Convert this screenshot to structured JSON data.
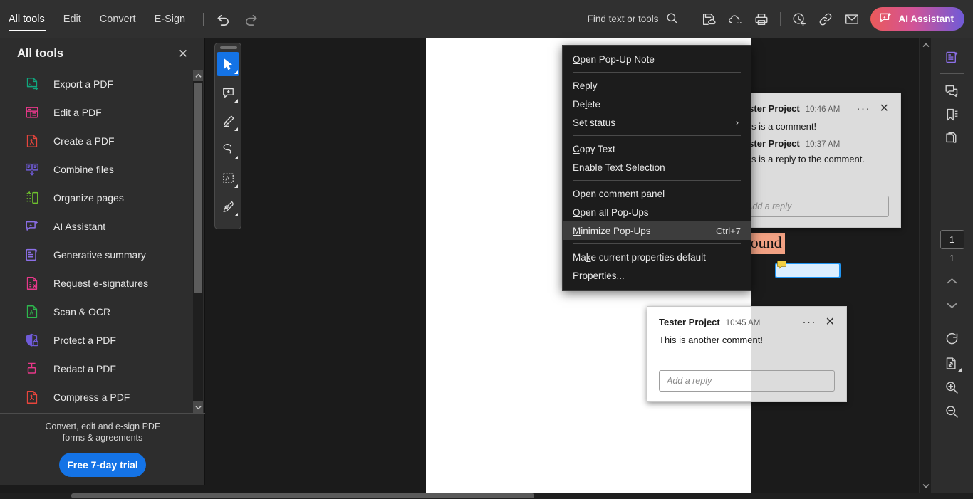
{
  "topbar": {
    "tabs": [
      {
        "label": "All tools",
        "active": true
      },
      {
        "label": "Edit",
        "active": false
      },
      {
        "label": "Convert",
        "active": false
      },
      {
        "label": "E-Sign",
        "active": false
      }
    ],
    "undo_icon": "undo-icon",
    "redo_icon": "redo-icon",
    "find_placeholder": "Find text or tools",
    "search_icon": "search-icon",
    "actions": [
      {
        "name": "save-to-cloud-icon",
        "label": "Save"
      },
      {
        "name": "cloud-storage-icon",
        "label": "Cloud"
      },
      {
        "name": "print-icon",
        "label": "Print"
      },
      {
        "name": "add-stamp-icon",
        "label": "Add Stamp"
      },
      {
        "name": "share-link-icon",
        "label": "Share link"
      },
      {
        "name": "email-icon",
        "label": "Email"
      }
    ],
    "ai_assistant": {
      "label": "AI Assistant",
      "icon": "ai-sparkle-icon",
      "gradient_from": "#eb5a5a",
      "gradient_to": "#6f5bd8"
    }
  },
  "sidebar": {
    "title": "All tools",
    "close_icon": "close-icon",
    "items": [
      {
        "label": "Export a PDF",
        "icon": "export-pdf-icon",
        "color": "#0fa87f"
      },
      {
        "label": "Edit a PDF",
        "icon": "edit-pdf-icon",
        "color": "#e8388a"
      },
      {
        "label": "Create a PDF",
        "icon": "create-pdf-icon",
        "color": "#e8453c"
      },
      {
        "label": "Combine files",
        "icon": "combine-files-icon",
        "color": "#6f5bd8"
      },
      {
        "label": "Organize pages",
        "icon": "organize-pages-icon",
        "color": "#6ec02e"
      },
      {
        "label": "AI Assistant",
        "icon": "ai-assistant-icon",
        "color": "#8c6fe8"
      },
      {
        "label": "Generative summary",
        "icon": "generative-summary-icon",
        "color": "#8c6fe8"
      },
      {
        "label": "Request e-signatures",
        "icon": "request-esignatures-icon",
        "color": "#e8388a"
      },
      {
        "label": "Scan & OCR",
        "icon": "scan-ocr-icon",
        "color": "#2db84d"
      },
      {
        "label": "Protect a PDF",
        "icon": "protect-pdf-icon",
        "color": "#6f5bd8"
      },
      {
        "label": "Redact a PDF",
        "icon": "redact-pdf-icon",
        "color": "#e8388a"
      },
      {
        "label": "Compress a PDF",
        "icon": "compress-pdf-icon",
        "color": "#e8453c"
      }
    ],
    "footer": {
      "promo": "Convert, edit and e-sign PDF forms & agreements",
      "trial_button": "Free 7-day trial",
      "trial_color": "#1473e6"
    }
  },
  "annotation_toolbar": {
    "tools": [
      {
        "name": "select-tool",
        "icon": "cursor-arrow-icon",
        "active": true
      },
      {
        "name": "add-comment-tool",
        "icon": "comment-plus-icon",
        "active": false
      },
      {
        "name": "highlight-tool",
        "icon": "highlighter-icon",
        "active": false
      },
      {
        "name": "freehand-tool",
        "icon": "lasso-icon",
        "active": false
      },
      {
        "name": "text-selection-tool",
        "icon": "text-box-a-icon",
        "active": false
      },
      {
        "name": "signature-tool",
        "icon": "fountain-pen-icon",
        "active": false
      }
    ]
  },
  "document": {
    "highlighted_text": "The Hound",
    "highlight_color": "#f2a183",
    "note_icon": "sticky-note-icon",
    "selection_icon": "sticky-note-small-icon"
  },
  "context_menu": {
    "items": [
      {
        "label": "Open Pop-Up Note",
        "mnemonic": "O",
        "shortcut": "",
        "submenu": false,
        "highlight": false
      },
      {
        "separator": true
      },
      {
        "label": "Reply",
        "mnemonic": "y",
        "shortcut": "",
        "submenu": false,
        "highlight": false
      },
      {
        "label": "Delete",
        "mnemonic": "l",
        "shortcut": "",
        "submenu": false,
        "highlight": false
      },
      {
        "label": "Set status",
        "mnemonic": "t",
        "shortcut": "",
        "submenu": true,
        "highlight": false
      },
      {
        "separator": true
      },
      {
        "label": "Copy Text",
        "mnemonic": "C",
        "shortcut": "",
        "submenu": false,
        "highlight": false
      },
      {
        "label": "Enable Text Selection",
        "mnemonic": "T",
        "shortcut": "",
        "submenu": false,
        "highlight": false
      },
      {
        "separator": true
      },
      {
        "label": "Open comment panel",
        "mnemonic": "",
        "shortcut": "",
        "submenu": false,
        "highlight": false
      },
      {
        "label": "Open all Pop-Ups",
        "mnemonic": "O",
        "shortcut": "",
        "submenu": false,
        "highlight": false
      },
      {
        "label": "Minimize Pop-Ups",
        "mnemonic": "M",
        "shortcut": "Ctrl+7",
        "submenu": false,
        "highlight": true
      },
      {
        "separator": true
      },
      {
        "label": "Make current properties default",
        "mnemonic": "k",
        "shortcut": "",
        "submenu": false,
        "highlight": false
      },
      {
        "label": "Properties...",
        "mnemonic": "P",
        "shortcut": "",
        "submenu": false,
        "highlight": false
      }
    ]
  },
  "popups": [
    {
      "id": "popup-upper",
      "author": "Tester Project",
      "time": "10:46 AM",
      "body": "This is a comment!",
      "reply_author": "Tester Project",
      "reply_time": "10:37 AM",
      "reply_body": "This is a reply to the comment.",
      "reply_placeholder": "Add a reply",
      "more_icon": "more-options-icon",
      "close_icon": "close-icon"
    },
    {
      "id": "popup-lower",
      "author": "Tester Project",
      "time": "10:45 AM",
      "body": "This is another comment!",
      "reply_placeholder": "Add a reply",
      "more_icon": "more-options-icon",
      "close_icon": "close-icon"
    }
  ],
  "right_rail": {
    "top_tools": [
      {
        "name": "generative-summary-icon",
        "color": "#8c6fe8"
      },
      {
        "name": "comment-panel-icon",
        "color": "#d0d0d0"
      },
      {
        "name": "bookmark-icon",
        "color": "#d0d0d0"
      },
      {
        "name": "page-thumbnails-icon",
        "color": "#d0d0d0"
      }
    ],
    "page_current": "1",
    "page_total": "1",
    "nav": [
      {
        "name": "page-up-icon"
      },
      {
        "name": "page-down-icon"
      }
    ],
    "bottom_tools": [
      {
        "name": "rotate-icon"
      },
      {
        "name": "fit-page-icon"
      },
      {
        "name": "zoom-in-icon"
      },
      {
        "name": "zoom-out-icon"
      }
    ]
  }
}
